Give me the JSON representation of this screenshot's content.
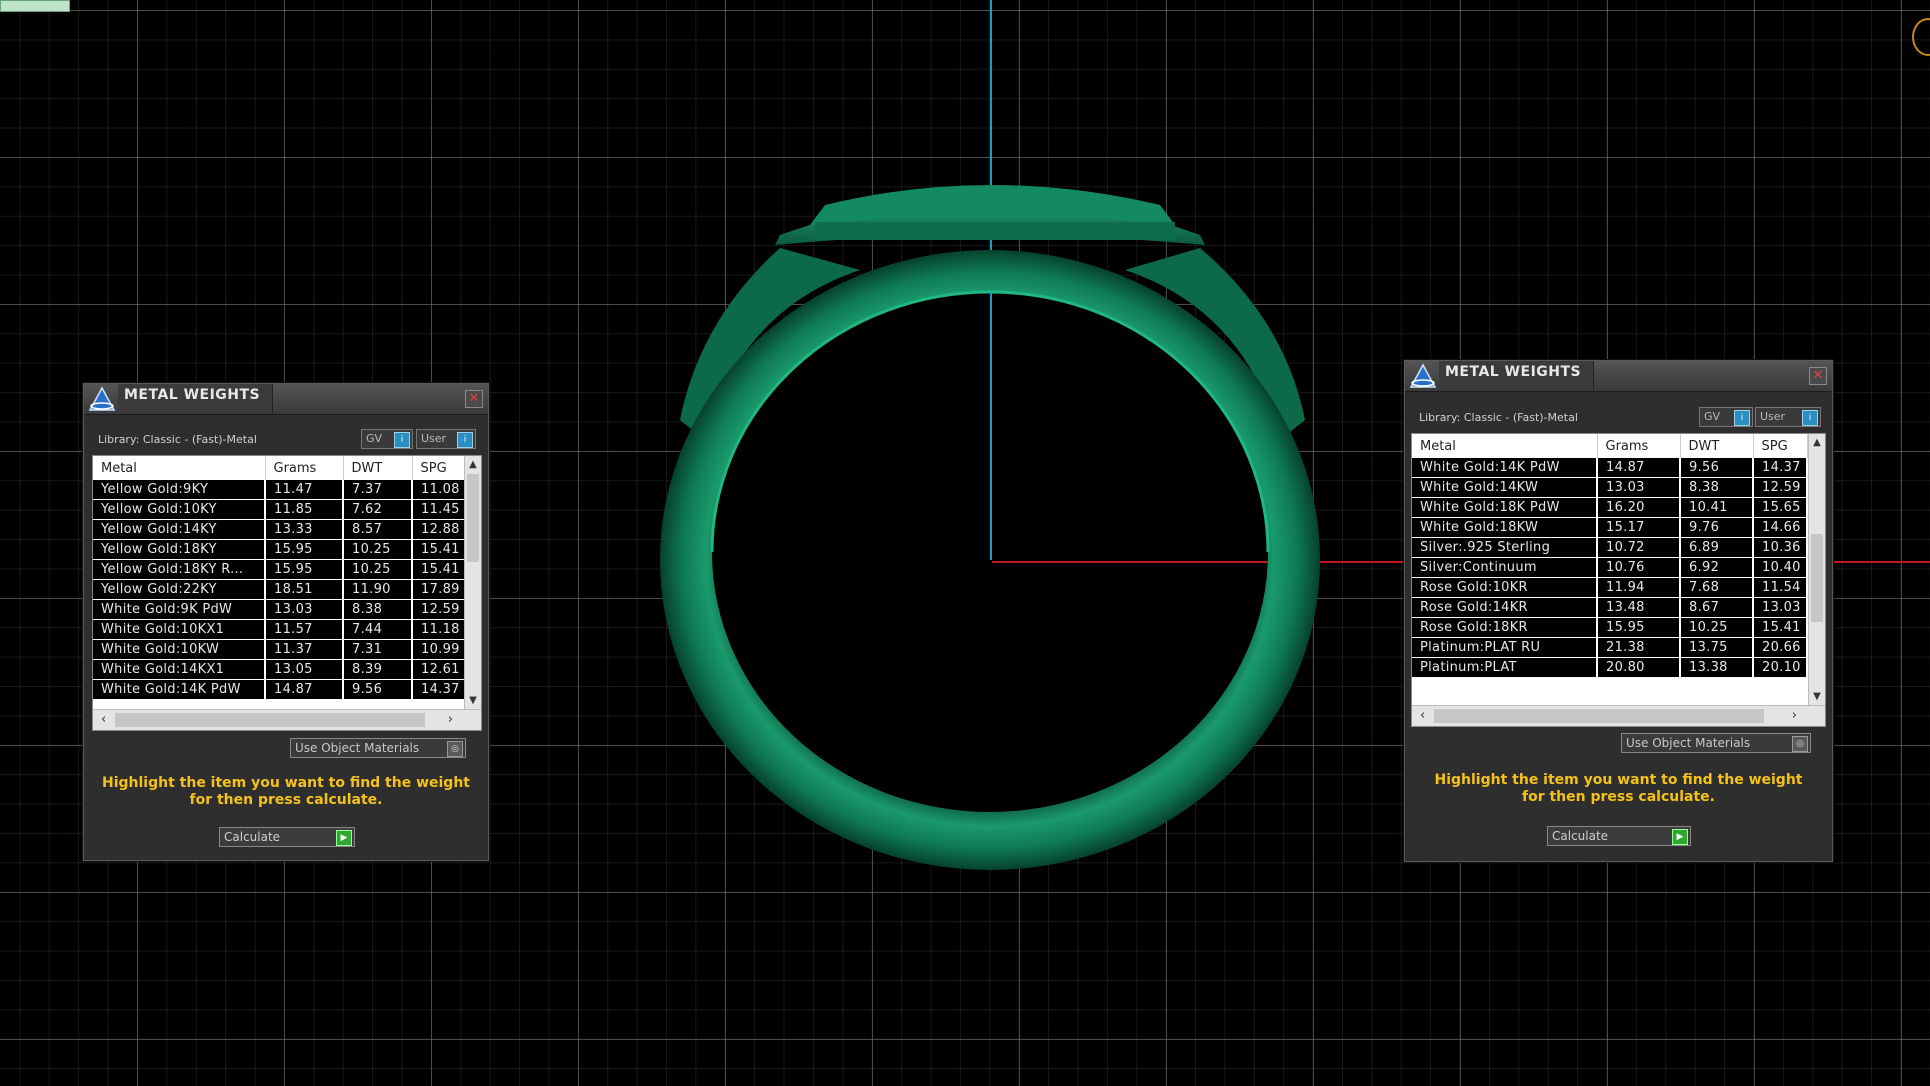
{
  "viewport": {
    "axis_colors": {
      "vertical": "#1aa0b8",
      "horizontal": "#c21818"
    },
    "model_color": "#0f7a55"
  },
  "panels": [
    {
      "title": "METAL WEIGHTS",
      "library": "Library: Classic - (Fast)-Metal",
      "toggle_gv": "GV",
      "toggle_user": "User",
      "columns": [
        "Metal",
        "Grams",
        "DWT",
        "SPG"
      ],
      "rows": [
        [
          "Yellow Gold:9KY",
          "11.47",
          "7.37",
          "11.08"
        ],
        [
          "Yellow Gold:10KY",
          "11.85",
          "7.62",
          "11.45"
        ],
        [
          "Yellow Gold:14KY",
          "13.33",
          "8.57",
          "12.88"
        ],
        [
          "Yellow Gold:18KY",
          "15.95",
          "10.25",
          "15.41"
        ],
        [
          "Yellow Gold:18KY R...",
          "15.95",
          "10.25",
          "15.41"
        ],
        [
          "Yellow Gold:22KY",
          "18.51",
          "11.90",
          "17.89"
        ],
        [
          "White Gold:9K PdW",
          "13.03",
          "8.38",
          "12.59"
        ],
        [
          "White Gold:10KX1",
          "11.57",
          "7.44",
          "11.18"
        ],
        [
          "White Gold:10KW",
          "11.37",
          "7.31",
          "10.99"
        ],
        [
          "White Gold:14KX1",
          "13.05",
          "8.39",
          "12.61"
        ],
        [
          "White Gold:14K PdW",
          "14.87",
          "9.56",
          "14.37"
        ]
      ],
      "use_object_materials": "Use Object Materials",
      "hint_line1": "Highlight the item you want to find the weight",
      "hint_line2": "for then press calculate.",
      "calculate": "Calculate"
    },
    {
      "title": "METAL WEIGHTS",
      "library": "Library: Classic - (Fast)-Metal",
      "toggle_gv": "GV",
      "toggle_user": "User",
      "columns": [
        "Metal",
        "Grams",
        "DWT",
        "SPG"
      ],
      "rows": [
        [
          "White Gold:14K PdW",
          "14.87",
          "9.56",
          "14.37"
        ],
        [
          "White Gold:14KW",
          "13.03",
          "8.38",
          "12.59"
        ],
        [
          "White Gold:18K PdW",
          "16.20",
          "10.41",
          "15.65"
        ],
        [
          "White Gold:18KW",
          "15.17",
          "9.76",
          "14.66"
        ],
        [
          "Silver:.925 Sterling",
          "10.72",
          "6.89",
          "10.36"
        ],
        [
          "Silver:Continuum",
          "10.76",
          "6.92",
          "10.40"
        ],
        [
          "Rose Gold:10KR",
          "11.94",
          "7.68",
          "11.54"
        ],
        [
          "Rose Gold:14KR",
          "13.48",
          "8.67",
          "13.03"
        ],
        [
          "Rose Gold:18KR",
          "15.95",
          "10.25",
          "15.41"
        ],
        [
          "Platinum:PLAT RU",
          "21.38",
          "13.75",
          "20.66"
        ],
        [
          "Platinum:PLAT",
          "20.80",
          "13.38",
          "20.10"
        ]
      ],
      "use_object_materials": "Use Object Materials",
      "hint_line1": "Highlight the item you want to find the weight",
      "hint_line2": "for then press calculate.",
      "calculate": "Calculate"
    }
  ],
  "scrollbars": {
    "left_vertical_position": 0.0,
    "right_vertical_position": 1.0
  }
}
